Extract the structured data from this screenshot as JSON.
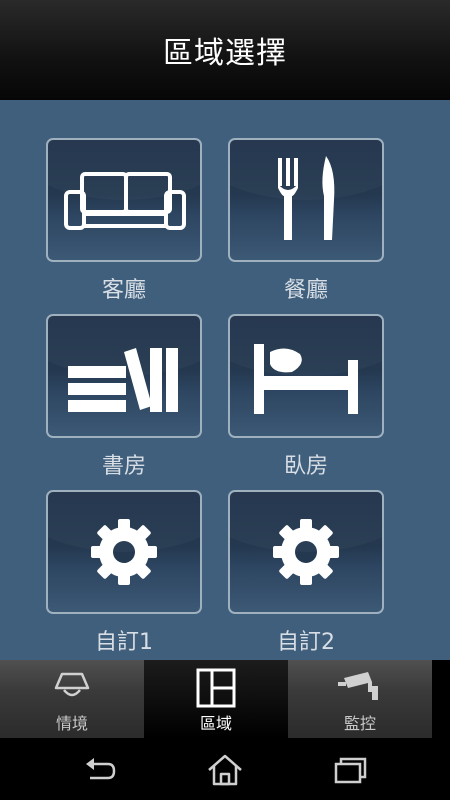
{
  "header": {
    "title": "區域選擇"
  },
  "tiles": [
    {
      "label": "客廳",
      "icon": "sofa-icon"
    },
    {
      "label": "餐廳",
      "icon": "fork-knife-icon"
    },
    {
      "label": "書房",
      "icon": "books-icon"
    },
    {
      "label": "臥房",
      "icon": "bed-icon"
    },
    {
      "label": "自訂1",
      "icon": "gear-icon"
    },
    {
      "label": "自訂2",
      "icon": "gear-icon"
    }
  ],
  "tabs": [
    {
      "label": "情境",
      "icon": "lamp-icon",
      "active": false
    },
    {
      "label": "區域",
      "icon": "floorplan-icon",
      "active": true
    },
    {
      "label": "監控",
      "icon": "camera-icon",
      "active": false
    }
  ],
  "navbar": {
    "icons": [
      "back-icon",
      "home-icon",
      "recent-apps-icon"
    ]
  },
  "colors": {
    "background": "#3f5f7c",
    "tile": "#24384f",
    "tile_border": "#9fb0bf"
  }
}
